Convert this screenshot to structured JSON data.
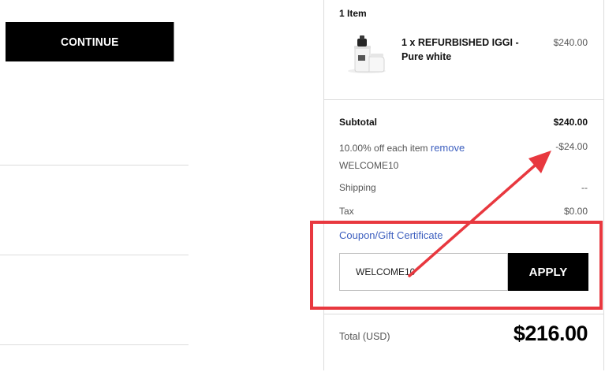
{
  "checkout": {
    "continue_label": "CONTINUE"
  },
  "summary": {
    "items_count": "1 Item",
    "product": {
      "name": "1 x REFURBISHED IGGI - Pure white",
      "price": "$240.00",
      "image_icon": "product-image-icon"
    },
    "subtotal_label": "Subtotal",
    "subtotal_value": "$240.00",
    "discount_text": "10.00% off each item",
    "discount_remove": "remove",
    "discount_code": "WELCOME10",
    "discount_value": "-$24.00",
    "shipping_label": "Shipping",
    "shipping_value": "--",
    "tax_label": "Tax",
    "tax_value": "$0.00",
    "coupon_link": "Coupon/Gift Certificate",
    "coupon_input_value": "WELCOME10",
    "apply_label": "APPLY",
    "total_label": "Total (USD)",
    "total_value": "$216.00"
  },
  "colors": {
    "link": "#3d5fbf",
    "annotation": "#e8383f",
    "button_bg": "#000000"
  }
}
